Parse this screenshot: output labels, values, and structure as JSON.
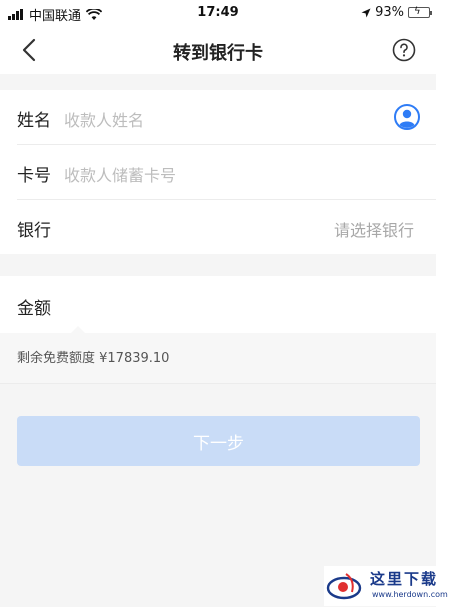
{
  "status_bar": {
    "carrier": "中国联通",
    "time": "17:49",
    "battery": "93%"
  },
  "nav": {
    "title": "转到银行卡"
  },
  "form": {
    "name": {
      "label": "姓名",
      "placeholder": "收款人姓名"
    },
    "card": {
      "label": "卡号",
      "placeholder": "收款人储蓄卡号"
    },
    "bank": {
      "label": "银行",
      "placeholder": "请选择银行"
    },
    "amount": {
      "label": "金额"
    },
    "quota": "剩余免费额度 ¥17839.10"
  },
  "next_button": {
    "label": "下一步"
  },
  "watermark": {
    "text": "这里下载",
    "url": "www.herdown.com"
  },
  "colors": {
    "accent": "#2e7cf6",
    "button_disabled": "#c9dcf7",
    "background": "#f5f5f5"
  }
}
